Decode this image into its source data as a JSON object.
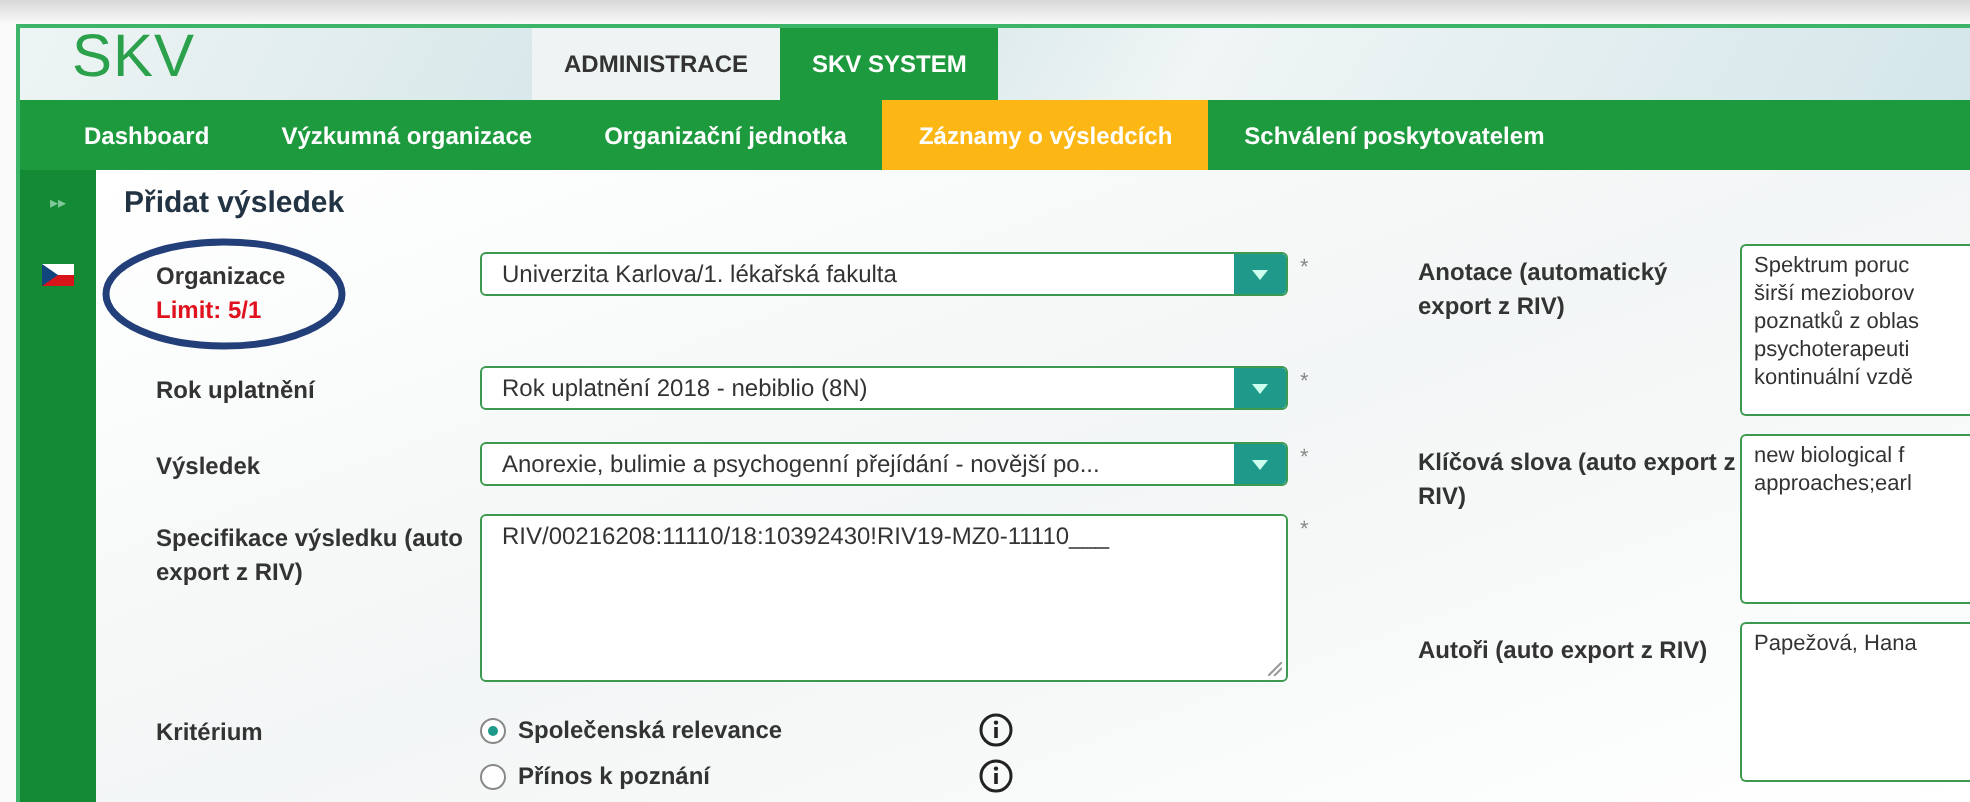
{
  "logo": "SKV",
  "top_tabs": [
    {
      "label": "ADMINISTRACE",
      "selected": false
    },
    {
      "label": "SKV SYSTEM",
      "selected": true
    }
  ],
  "nav": [
    {
      "label": "Dashboard",
      "selected": false
    },
    {
      "label": "Výzkumná organizace",
      "selected": false
    },
    {
      "label": "Organizační jednotka",
      "selected": false
    },
    {
      "label": "Záznamy o výsledcích",
      "selected": true
    },
    {
      "label": "Schválení poskytovatelem",
      "selected": false
    }
  ],
  "sidebar": {
    "toggle": "▸▸"
  },
  "page_title": "Přidat výsledek",
  "left_form": [
    {
      "kind": "select",
      "label": "Organizace",
      "note": "Limit: 5/1",
      "highlighted": true,
      "value": "Univerzita Karlova/1. lékařská fakulta",
      "required": "*"
    },
    {
      "kind": "select",
      "label": "Rok uplatnění",
      "value": "Rok uplatnění 2018 - nebiblio (8N)",
      "required": "*"
    },
    {
      "kind": "select",
      "label": "Výsledek",
      "value": "Anorexie, bulimie a psychogenní přejídání - novější po...",
      "required": "*"
    },
    {
      "kind": "textarea",
      "label": "Specifikace výsledku (auto export z RIV)",
      "value": "RIV/00216208:11110/18:10392430!RIV19-MZ0-11110___",
      "required": "*"
    },
    {
      "kind": "radio",
      "label": "Kritérium",
      "options": [
        {
          "label": "Společenská relevance",
          "selected": true
        },
        {
          "label": "Přínos k poznání",
          "selected": false
        }
      ]
    }
  ],
  "right_form": [
    {
      "label": "Anotace (automatický export z RIV)",
      "lines": [
        "Spektrum poruc",
        "širší mezioborov",
        "poznatků z oblas",
        "psychoterapeuti",
        "kontinuální vzdě"
      ]
    },
    {
      "label": "Klíčová slova (auto export z RIV)",
      "lines": [
        "new biological f",
        "approaches;earl"
      ]
    },
    {
      "label": "Autoři (auto export z RIV)",
      "lines": [
        "Papežová, Hana"
      ]
    }
  ]
}
